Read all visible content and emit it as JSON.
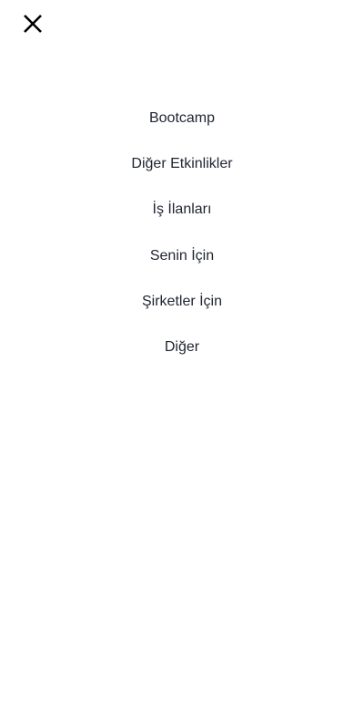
{
  "header": {
    "close_icon": "close-icon"
  },
  "menu": {
    "items": [
      {
        "label": "Bootcamp"
      },
      {
        "label": "Diğer Etkinlikler"
      },
      {
        "label": "İş İlanları"
      },
      {
        "label": "Senin İçin"
      },
      {
        "label": "Şirketler İçin"
      },
      {
        "label": "Diğer"
      }
    ]
  },
  "colors": {
    "background": "#ffffff",
    "text": "#1f2430",
    "icon": "#000000"
  }
}
